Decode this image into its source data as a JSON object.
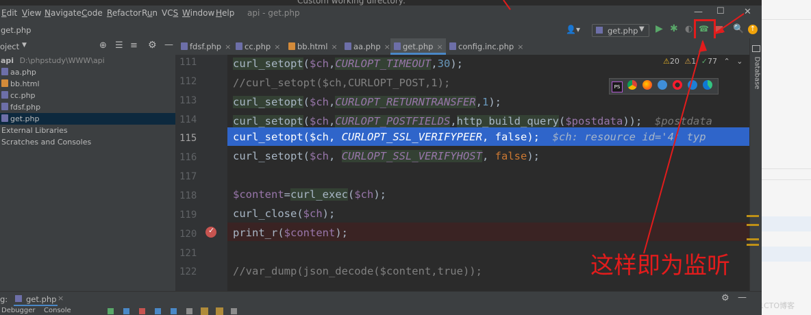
{
  "window": {
    "title": "api - get.php",
    "behind_text": "Custom working directory:"
  },
  "menu": [
    "Edit",
    "View",
    "Navigate",
    "Code",
    "Refactor",
    "Run",
    "VCS",
    "Window",
    "Help"
  ],
  "menu_mnemonics": [
    "E",
    "V",
    "N",
    "C",
    "R",
    "u",
    "S",
    "W",
    "H"
  ],
  "navbar": {
    "breadcrumb": "get.php",
    "run_config": "get.php"
  },
  "project_panel": {
    "header": "oject",
    "root_name": "api",
    "root_path": "D:\\phpstudy\\WWW\\api",
    "files": [
      {
        "name": "aa.php",
        "type": "php"
      },
      {
        "name": "bb.html",
        "type": "html"
      },
      {
        "name": "cc.php",
        "type": "php"
      },
      {
        "name": "fdsf.php",
        "type": "php"
      },
      {
        "name": "get.php",
        "type": "php"
      }
    ],
    "external": "External Libraries",
    "scratches": "Scratches and Consoles"
  },
  "editor_tabs": [
    {
      "label": "fdsf.php",
      "active": false
    },
    {
      "label": "cc.php",
      "active": false
    },
    {
      "label": "bb.html",
      "active": false
    },
    {
      "label": "aa.php",
      "active": false
    },
    {
      "label": "get.php",
      "active": true
    },
    {
      "label": "config.inc.php",
      "active": false
    }
  ],
  "inspections": {
    "warnings": "20",
    "weak_warnings": "1",
    "ok": "77"
  },
  "line_numbers": [
    "111",
    "112",
    "113",
    "114",
    "115",
    "116",
    "117",
    "118",
    "119",
    "120",
    "121",
    "122"
  ],
  "code": {
    "l111": {
      "fn": "curl_setopt",
      "open": "(",
      "var": "$ch",
      "sep": ",",
      "const": "CURLOPT_TIMEOUT",
      "sep2": ",",
      "num": "30",
      "close": ");"
    },
    "l112": "//curl_setopt($ch,CURLOPT_POST,1);",
    "l113": {
      "fn": "curl_setopt",
      "open": "(",
      "var": "$ch",
      "sep": ",",
      "const": "CURLOPT_RETURNTRANSFER",
      "sep2": ",",
      "num": "1",
      "close": ");"
    },
    "l114": {
      "fn": "curl_setopt",
      "open": "(",
      "var": "$ch",
      "sep": ",",
      "const": "CURLOPT_POSTFIELDS",
      "sep2": ",",
      "fn2": "http_build_query",
      "open2": "(",
      "var2": "$postdata",
      "close": "));",
      "hint": "$postdata"
    },
    "l115": {
      "fn": "curl_setopt",
      "open": "(",
      "var": "$ch",
      "sep": ", ",
      "const": "CURLOPT_SSL_VERIFYPEER",
      "sep2": ", ",
      "kw": "false",
      "close": ");",
      "hint": "$ch: resource id='4' typ"
    },
    "l116": {
      "fn": "curl_setopt",
      "open": "(",
      "var": "$ch",
      "sep": ", ",
      "const": "CURLOPT_SSL_VERIFYHOST",
      "sep2": ", ",
      "kw": "false",
      "close": ");"
    },
    "l118": {
      "var": "$content",
      "eq": "=",
      "fn": "curl_exec",
      "open": "(",
      "var2": "$ch",
      "close": ");"
    },
    "l119": {
      "fn": "curl_close",
      "open": "(",
      "var": "$ch",
      "close": ");"
    },
    "l120": {
      "fn": "print_r",
      "open": "(",
      "var": "$content",
      "close": ");"
    },
    "l122": "//var_dump(json_decode($content,true));"
  },
  "right_strip_label": "Database",
  "status": {
    "label": "g:",
    "tab": "get.php"
  },
  "bottom_tabs": [
    "Debugger",
    "Console"
  ],
  "annotation": "这样即为监听",
  "watermark": "@51CTO博客",
  "colors": {
    "accent_red": "#e21c1c",
    "selection": "#2f65ca",
    "breakpoint_line": "#3a2323"
  }
}
